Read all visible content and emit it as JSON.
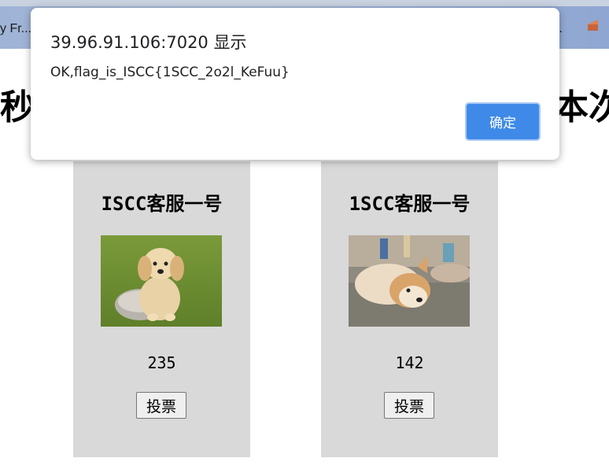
{
  "browser": {
    "tab_left_text": "y Fr...",
    "tab_right_text": ".."
  },
  "page": {
    "heading_left": "秒",
    "heading_right": "本次"
  },
  "cards": [
    {
      "name": "ISCC客服一号",
      "photo": "puppy-photo",
      "votes": "235",
      "vote_label": "投票"
    },
    {
      "name": "1SCC客服一号",
      "photo": "shiba-photo",
      "votes": "142",
      "vote_label": "投票"
    }
  ],
  "dialog": {
    "title": "39.96.91.106:7020 显示",
    "message": "OK,flag_is_ISCC{1SCC_2o2l_KeFuu}",
    "ok_label": "确定"
  },
  "colors": {
    "card_bg": "#d9d9d9",
    "ok_button": "#3f8ae8"
  }
}
